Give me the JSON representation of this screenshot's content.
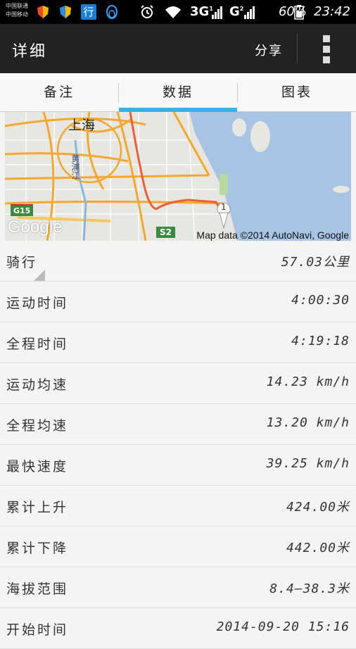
{
  "status_bar": {
    "carrier_line1": "中国联通",
    "carrier_line2": "中国移动",
    "app_icon_label": "行",
    "network1": "3G",
    "network2": "G",
    "sim1": "1",
    "sim2": "2",
    "battery": "60%",
    "time": "23:42"
  },
  "appbar": {
    "title": "详细",
    "share_label": "分享"
  },
  "tabs": [
    {
      "label": "备注",
      "active": false
    },
    {
      "label": "数据",
      "active": true
    },
    {
      "label": "图表",
      "active": false
    }
  ],
  "map": {
    "city_label": "上海",
    "road_label": "黄浦江",
    "shield_g15": "G15",
    "shield_s2": "S2",
    "marker_label": "1",
    "logo": "Google",
    "attribution": "Map data ©2014 AutoNavi, Google"
  },
  "stats": [
    {
      "label": "骑行",
      "value": "57.03公里"
    },
    {
      "label": "运动时间",
      "value": "4:00:30"
    },
    {
      "label": "全程时间",
      "value": "4:19:18"
    },
    {
      "label": "运动均速",
      "value": "14.23 km/h"
    },
    {
      "label": "全程均速",
      "value": "13.20 km/h"
    },
    {
      "label": "最快速度",
      "value": "39.25 km/h"
    },
    {
      "label": "累计上升",
      "value": "424.00米"
    },
    {
      "label": "累计下降",
      "value": "442.00米"
    },
    {
      "label": "海拔范围",
      "value": "8.4—38.3米"
    },
    {
      "label": "开始时间",
      "value": "2014-09-20 15:16"
    }
  ],
  "colors": {
    "accent": "#33b5e5",
    "appbar": "#222222",
    "water": "#a8c4e4",
    "land": "#e8e6e0",
    "road_major": "#f2a830",
    "route": "#e8603a"
  }
}
